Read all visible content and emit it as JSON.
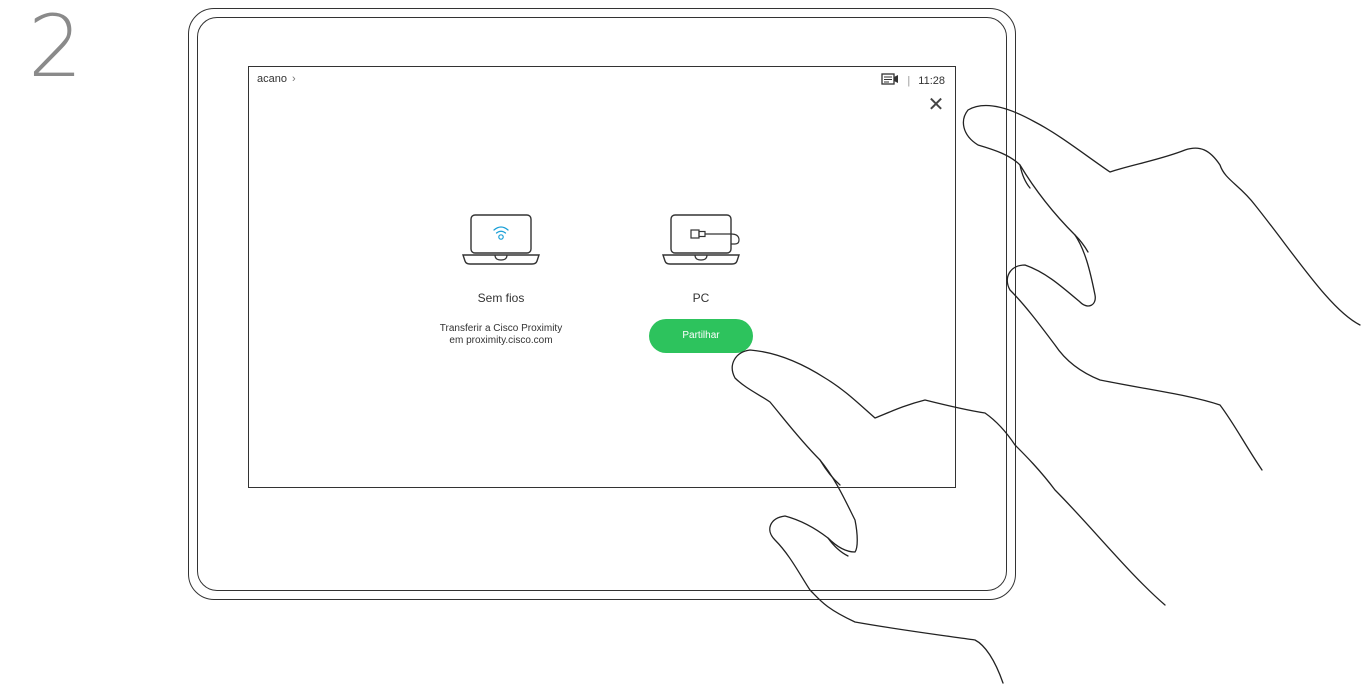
{
  "step": "2",
  "topbar": {
    "room_name": "acano",
    "room_chevron": "›",
    "separator": "|",
    "time": "11:28"
  },
  "icons": {
    "close": "close-icon",
    "camera": "self-view-camera-icon",
    "wireless": "wireless-laptop-icon",
    "pc": "cable-laptop-icon"
  },
  "options": {
    "wireless": {
      "title": "Sem fios",
      "description_line1": "Transferir a Cisco Proximity",
      "description_line2": "em proximity.cisco.com"
    },
    "pc": {
      "title": "PC",
      "button_label": "Partilhar"
    }
  },
  "colors": {
    "accent_green": "#2dc35d",
    "wifi_blue": "#1ba0d7"
  }
}
